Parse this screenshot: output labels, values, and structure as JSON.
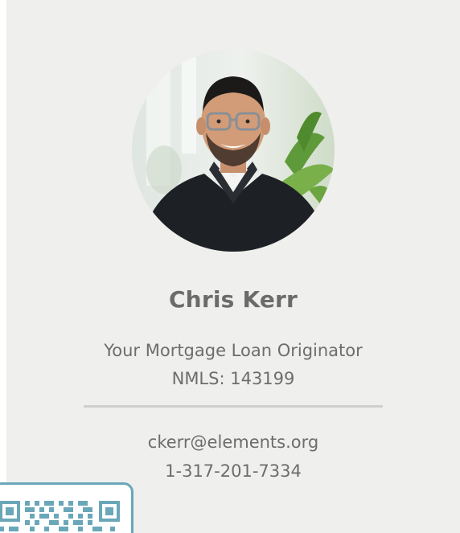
{
  "profile": {
    "name": "Chris Kerr",
    "title": "Your Mortgage Loan Originator",
    "nmls": "NMLS: 143199",
    "email": "ckerr@elements.org",
    "phone": "1-317-201-7334",
    "photo": "portrait-photo"
  },
  "qr": {
    "icon": "qr-code-icon"
  },
  "colors": {
    "card_background": "#efefed",
    "name_text": "#6b6b6b",
    "body_text": "#6d6d6d",
    "divider": "#cfcfcd",
    "qr_accent": "#6aa7b9"
  }
}
